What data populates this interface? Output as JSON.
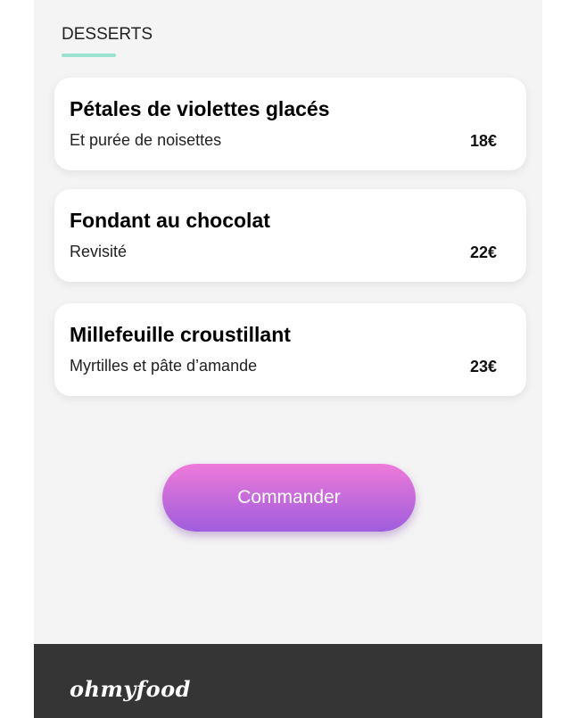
{
  "section": {
    "title": "DESSERTS",
    "accent_color": "#99e2d0"
  },
  "dishes": [
    {
      "name": "Pétales de violettes glacés",
      "description": "Et purée de noisettes",
      "price": "18€"
    },
    {
      "name": "Fondant au chocolat",
      "description": "Revisité",
      "price": "22€"
    },
    {
      "name": "Millefeuille croustillant",
      "description": "Myrtilles et pâte d’amande",
      "price": "23€"
    }
  ],
  "order_button": {
    "label": "Commander",
    "gradient_top": "#ee7ad9",
    "gradient_bottom": "#9f5ddd"
  },
  "footer": {
    "logo": "ohmyfood",
    "background": "#353535"
  }
}
